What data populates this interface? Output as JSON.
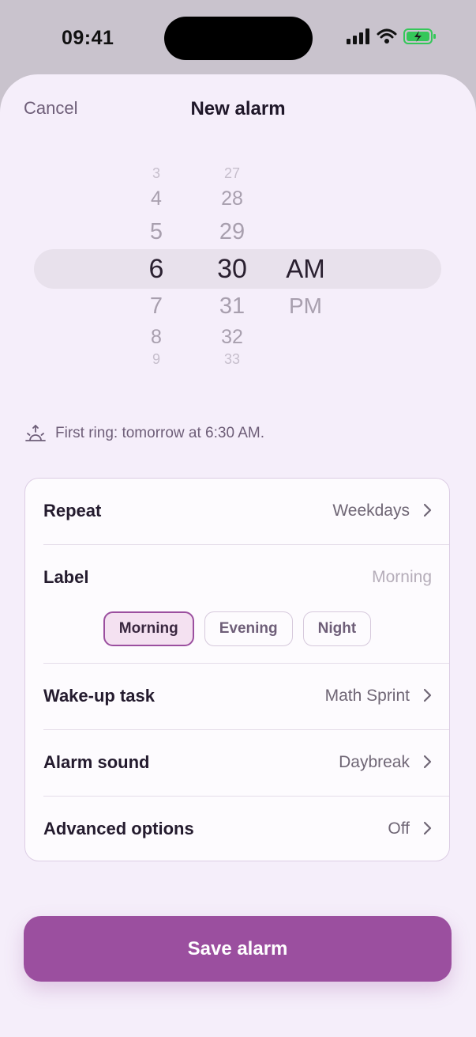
{
  "status_bar": {
    "time": "09:41"
  },
  "nav": {
    "cancel": "Cancel",
    "title": "New alarm"
  },
  "picker": {
    "hours": [
      "3",
      "4",
      "5",
      "6",
      "7",
      "8",
      "9"
    ],
    "minutes": [
      "27",
      "28",
      "29",
      "30",
      "31",
      "32",
      "33"
    ],
    "periods": [
      "AM",
      "PM"
    ],
    "selected": {
      "hour": "6",
      "minute": "30",
      "period": "AM"
    }
  },
  "first_ring": "First ring: tomorrow at 6:30 AM.",
  "settings": {
    "repeat": {
      "label": "Repeat",
      "value": "Weekdays"
    },
    "label": {
      "label": "Label",
      "placeholder": "Morning",
      "chips": [
        "Morning",
        "Evening",
        "Night"
      ],
      "selected_chip": "Morning"
    },
    "wake_task": {
      "label": "Wake-up task",
      "value": "Math Sprint"
    },
    "sound": {
      "label": "Alarm sound",
      "value": "Daybreak"
    },
    "advanced": {
      "label": "Advanced options",
      "value": "Off"
    }
  },
  "save_button": "Save alarm",
  "colors": {
    "accent": "#9b4f9f",
    "sheet": "#f5eefa",
    "battery": "#34c759"
  }
}
